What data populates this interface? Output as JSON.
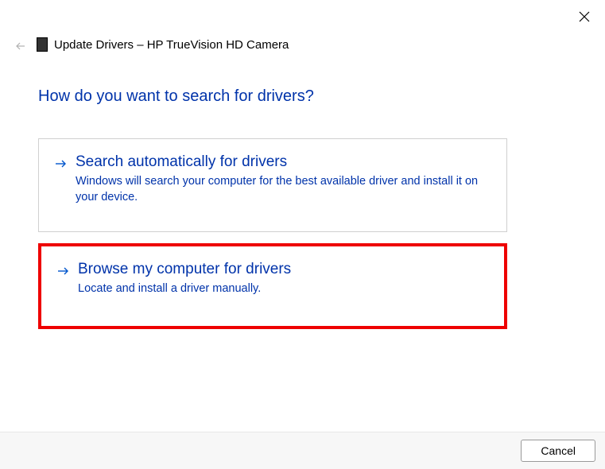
{
  "header": {
    "title": "Update Drivers – HP TrueVision HD Camera"
  },
  "main": {
    "heading": "How do you want to search for drivers?"
  },
  "options": {
    "auto": {
      "title": "Search automatically for drivers",
      "description": "Windows will search your computer for the best available driver and install it on your device."
    },
    "browse": {
      "title": "Browse my computer for drivers",
      "description": "Locate and install a driver manually."
    }
  },
  "footer": {
    "cancel_label": "Cancel"
  }
}
